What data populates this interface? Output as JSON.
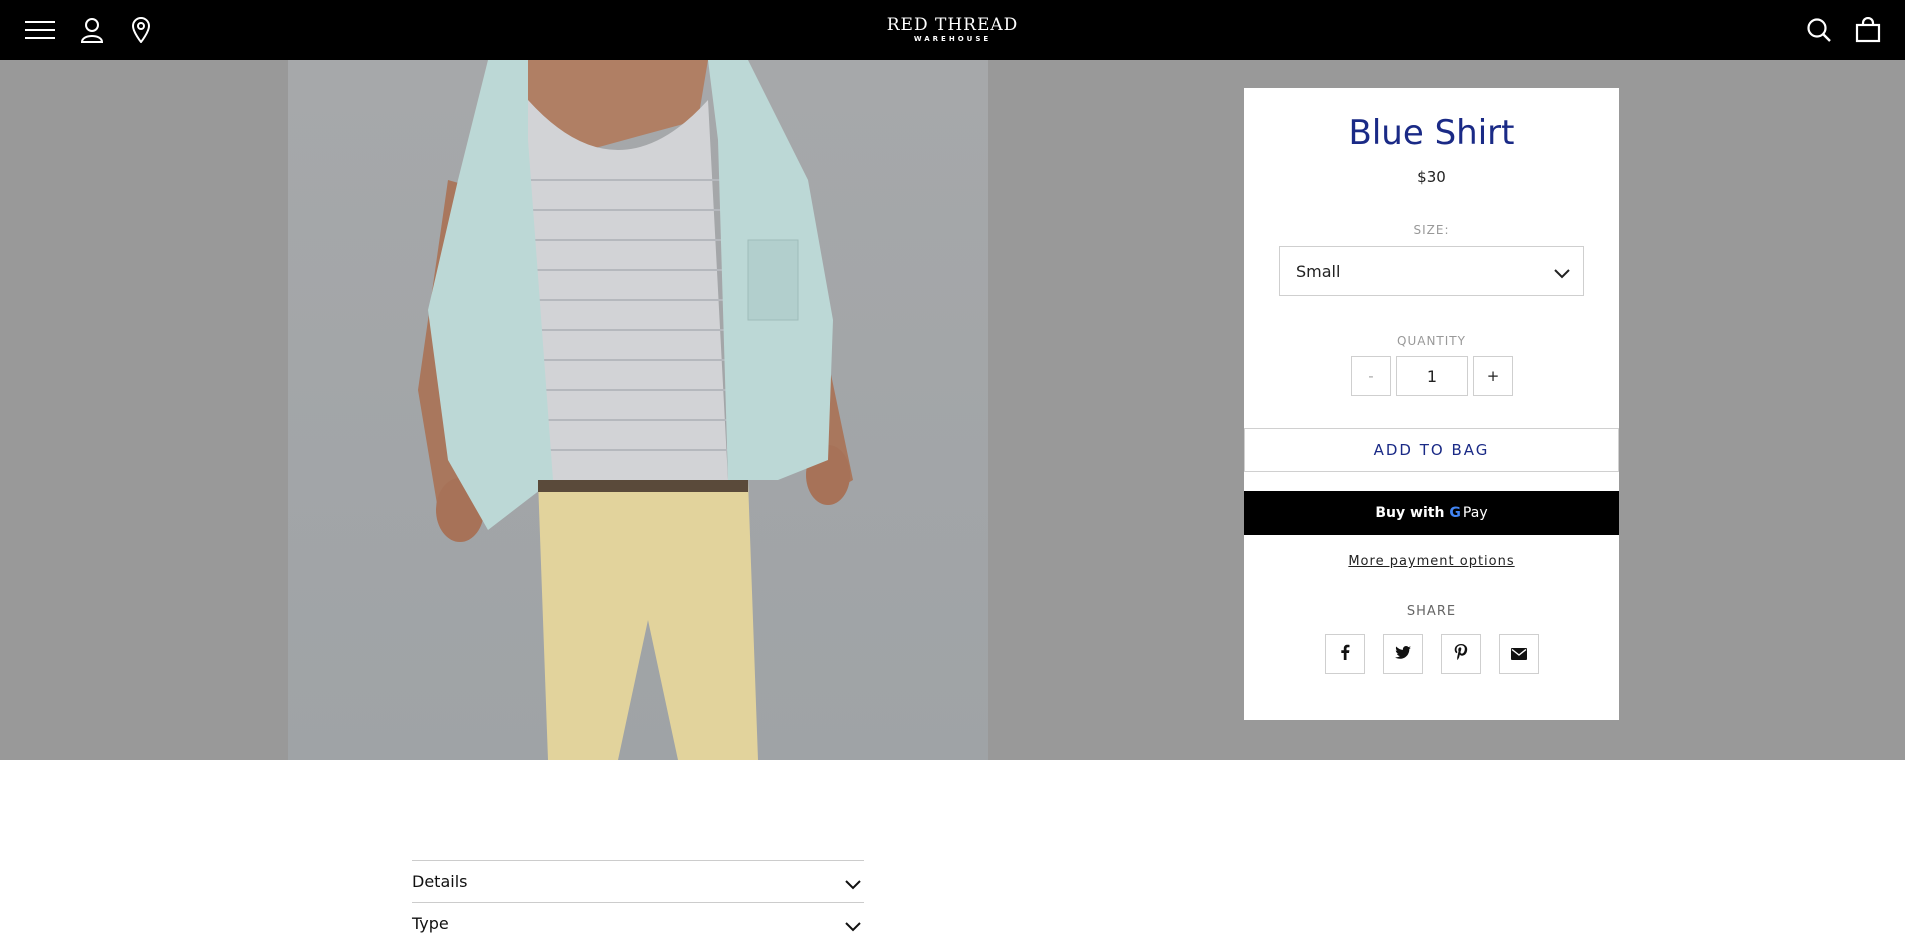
{
  "header": {
    "logo_line1": "RED THREAD",
    "logo_line2": "WAREHOUSE",
    "icons": [
      "menu-icon",
      "account-icon",
      "location-icon",
      "search-icon",
      "bag-icon"
    ]
  },
  "product": {
    "title": "Blue Shirt",
    "price": "$30",
    "size_label": "SIZE:",
    "size_value": "Small",
    "quantity_label": "QUANTITY",
    "quantity_value": "1",
    "minus_label": "-",
    "plus_label": "+",
    "add_to_bag": "ADD TO BAG",
    "gpay_buy_with": "Buy with",
    "gpay_g": "G",
    "gpay_pay": "Pay",
    "more_payment": "More payment options",
    "share_label": "SHARE",
    "share_icons": [
      "facebook-icon",
      "twitter-icon",
      "pinterest-icon",
      "email-icon"
    ]
  },
  "accordion": {
    "items": [
      {
        "label": "Details"
      },
      {
        "label": "Type"
      }
    ]
  },
  "colors": {
    "accent": "#1a2a86",
    "topbar": "#000000",
    "hero_bg": "#999999"
  }
}
